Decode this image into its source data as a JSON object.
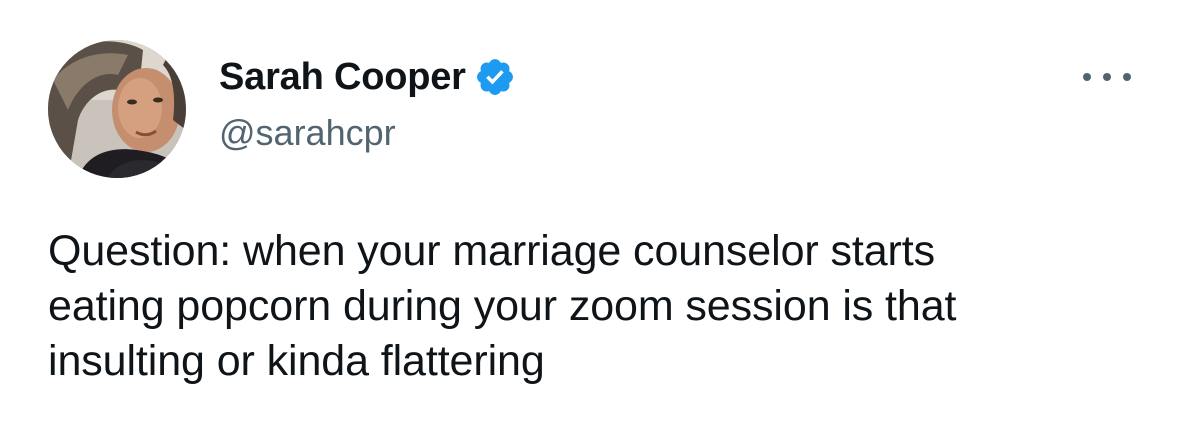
{
  "tweet": {
    "author": {
      "name": "Sarah Cooper",
      "handle": "@sarahcpr",
      "verified": true,
      "avatar_icon": "profile-photo"
    },
    "more_icon": "ellipsis-icon",
    "text_lines": [
      "Question: when your marriage counselor starts",
      "eating popcorn during your zoom session is that",
      "insulting or kinda flattering"
    ]
  },
  "colors": {
    "text_primary": "#0f1419",
    "text_secondary": "#536471",
    "verified_blue": "#1d9bf0",
    "background": "#ffffff"
  }
}
